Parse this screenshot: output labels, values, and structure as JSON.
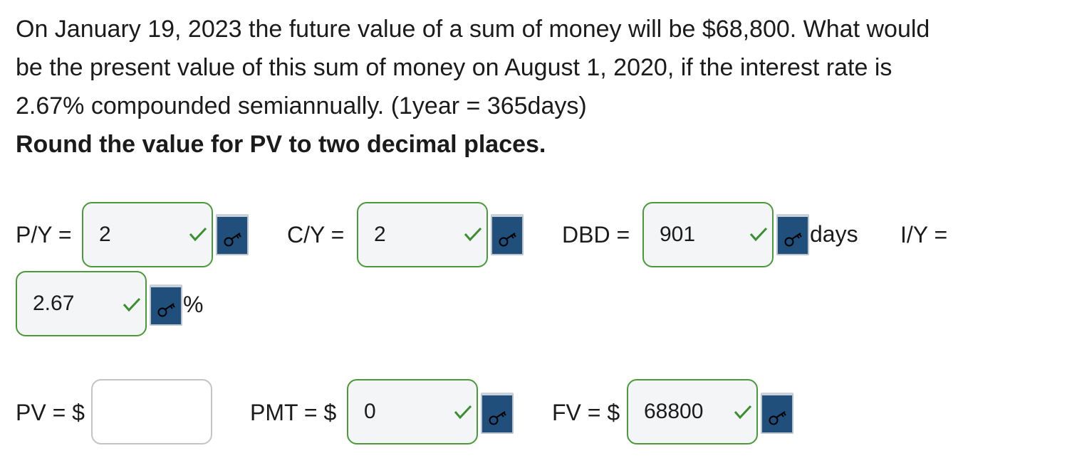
{
  "question": {
    "line1": "On January 19, 2023 the future value of a sum of money will be $68,800. What would",
    "line2": "be the present value of this sum of money on August 1, 2020, if the interest rate is",
    "line3": "2.67% compounded semiannually. (1year = 365days)",
    "instruction": "Round the value for PV to two decimal places."
  },
  "inputs": {
    "py": {
      "label": "P/Y =",
      "value": "2",
      "status": "correct"
    },
    "cy": {
      "label": "C/Y =",
      "value": "2",
      "status": "correct"
    },
    "dbd": {
      "label": "DBD =",
      "value": "901",
      "unit": "days",
      "status": "correct"
    },
    "iy": {
      "label": "I/Y =",
      "value": "2.67",
      "unit": "%",
      "status": "correct"
    },
    "pv": {
      "label": "PV = $",
      "value": "",
      "status": "empty"
    },
    "pmt": {
      "label": "PMT = $",
      "value": "0",
      "status": "correct"
    },
    "fv": {
      "label": "FV = $",
      "value": "68800",
      "status": "correct"
    }
  },
  "icons": {
    "check": "check-icon",
    "key": "key-icon"
  },
  "colors": {
    "correct_border": "#4a9a3a",
    "check_mark": "#3b8f2f",
    "field_fill": "#f3f5f7",
    "empty_border": "#c4c4c4",
    "key_button": "#1f4f7a"
  }
}
